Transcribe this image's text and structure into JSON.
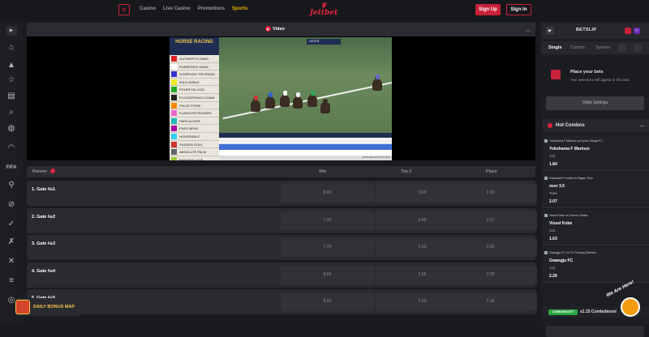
{
  "header": {
    "nav": [
      "Casino",
      "Live Casino",
      "Promotions",
      "Sports"
    ],
    "active_nav": "Sports",
    "logo_text": "Jettbet",
    "signup_label": "Sign Up",
    "signin_label": "Sign In"
  },
  "video": {
    "title": "Video",
    "stream": {
      "header": "HORSE RACING",
      "race_badge": "LISTEN",
      "runners": [
        "GUTWERT'S HAND",
        "ROBBERIES HAND",
        "SYMPHONY SPLENDID",
        "WILD NOBLE",
        "FEVER FALCON",
        "FLOODSPEAKS CHAIN",
        "PULSE POISE",
        "FLAWLESS REWARD",
        "PAPA OLIVER",
        "FAIRY BRAS",
        "HONORABLE",
        "SUDDEN SOUL",
        "ABSOLUTE PALM",
        "RADIANT LOVE"
      ],
      "timestamp": "10.06.2024 07:07:33 UTC"
    }
  },
  "table": {
    "columns": [
      "Runner",
      "Win",
      "Top 2",
      "Place"
    ],
    "rows": [
      {
        "name": "1. Gate №1",
        "win": "8.00",
        "top2": "3.65",
        "place": "2.30"
      },
      {
        "name": "2. Gate №2",
        "win": "7.30",
        "top2": "3.46",
        "place": "2.17"
      },
      {
        "name": "3. Gate №3",
        "win": "7.70",
        "top2": "3.52",
        "place": "2.20"
      },
      {
        "name": "4. Gate №4",
        "win": "8.00",
        "top2": "3.65",
        "place": "2.30"
      },
      {
        "name": "5. Gate №5",
        "win": "8.20",
        "top2": "3.33",
        "place": "2.18"
      }
    ]
  },
  "betslip": {
    "title": "BETSLIP",
    "tabs": [
      "Single",
      "Combo",
      "System"
    ],
    "empty_title": "Place your bets",
    "empty_sub": "Your selections will appear in this area",
    "odds_settings": "Odds Settings",
    "hot_combos": "Hot Combos",
    "combos": [
      {
        "match": "Yokohama F Marinos vs Kyoto Sanga FC",
        "pick": "Yokohama F Marinos",
        "market": "1x2",
        "price": "1.84"
      },
      {
        "match": "Kawasaki Frontale vs Sagan Tosu",
        "pick": "over 3.5",
        "market": "Total",
        "price": "2.07"
      },
      {
        "match": "Vissel Kobe vs Cerezo Osaka",
        "pick": "Vissel Kobe",
        "market": "1x2",
        "price": "1.63"
      },
      {
        "match": "Gwangju FC vs FC Pohang Steelers",
        "pick": "Gwangju FC",
        "market": "1x2",
        "price": "2.26"
      }
    ],
    "combo_tag": "COMBOBOOST",
    "combo_boost": "x1.15 Comboboost"
  },
  "bonus_label": "DAILY BONUS MAP",
  "chat_label": "We Are Here!",
  "colors": {
    "accent": "#c8213a",
    "active_nav": "#e7b400",
    "combo_tag": "#2aa843"
  }
}
